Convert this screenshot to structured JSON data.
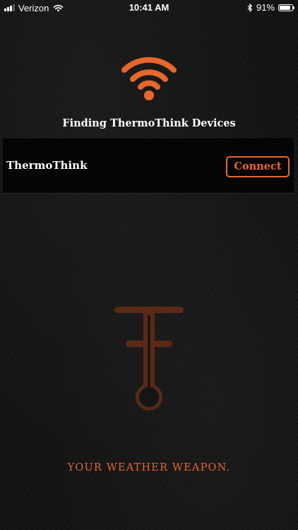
{
  "status_bar": {
    "carrier": "Verizon",
    "time": "10:41 AM",
    "battery_percent": "91%",
    "battery_level": 0.91,
    "signal_strength_bars": 3,
    "icons": [
      "signal-icon",
      "wifi-icon",
      "bluetooth-icon",
      "battery-icon"
    ]
  },
  "header": {
    "icon": "wifi-icon",
    "title": "Finding ThermoThink Devices"
  },
  "devices": [
    {
      "name": "ThermoThink",
      "action_label": "Connect"
    }
  ],
  "brand": {
    "logo": "thermometer-logo",
    "tagline": "YOUR WEATHER WEAPON."
  },
  "colors": {
    "accent": "#e8672b",
    "background": "#141414",
    "row_background": "#050505",
    "logo_brown": "#5a2a14"
  }
}
